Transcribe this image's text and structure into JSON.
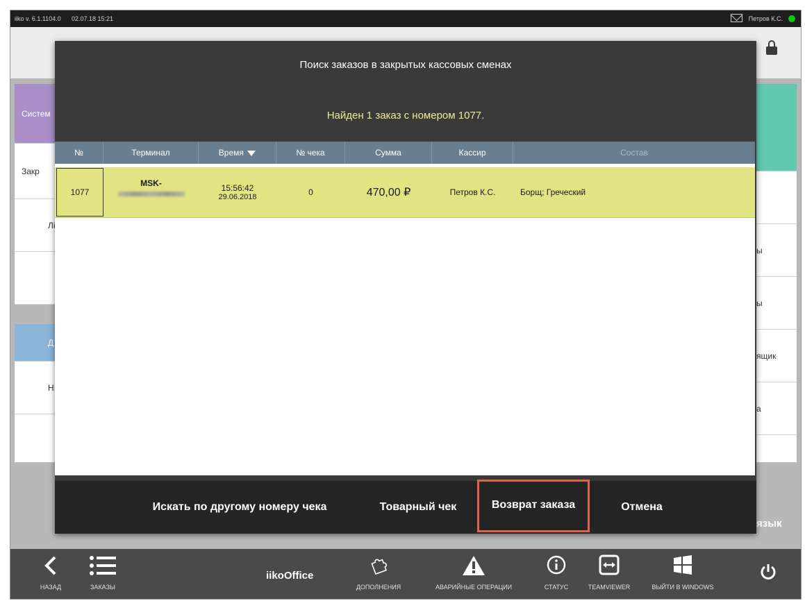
{
  "topbar": {
    "version": "iiko v. 6.1.1104.0",
    "datetime": "02.07.18  15:21",
    "user": "Петров К.С."
  },
  "background": {
    "left_tiles": [
      "Систем",
      "Закр",
      "Лі",
      "",
      "Д",
      "Н"
    ],
    "right_tiles": [
      "ы",
      "ы",
      "ящик",
      "а"
    ],
    "lang_label": "язык"
  },
  "modal": {
    "title": "Поиск заказов в закрытых кассовых сменах",
    "found_text": "Найден 1 заказ с номером 1077.",
    "columns": {
      "num": "№",
      "terminal": "Терминал",
      "time": "Время",
      "check": "№ чека",
      "sum": "Сумма",
      "cashier": "Кассир",
      "contents": "Состав"
    },
    "rows": [
      {
        "num": "1077",
        "terminal": "MSK-",
        "time": "15:56:42",
        "date": "29.06.2018",
        "check": "0",
        "sum": "470,00 ₽",
        "cashier": "Петров К.С.",
        "contents": "Борщ; Греческий"
      }
    ],
    "buttons": {
      "search_other": "Искать по другому номеру чека",
      "receipt": "Товарный чек",
      "return": "Возврат заказа",
      "cancel": "Отмена"
    }
  },
  "footer": {
    "back": "НАЗАД",
    "orders": "ЗАКАЗЫ",
    "iikooffice": "iikoOffice",
    "addons": "ДОПОЛНЕНИЯ",
    "emergency": "АВАРИЙНЫЕ ОПЕРАЦИИ",
    "status": "СТАТУС",
    "teamviewer": "TEAMVIEWER",
    "exit_windows": "ВЫЙТИ В WINDOWS"
  },
  "colors": {
    "modal_bg": "#3a3a3a",
    "header_row": "#687f92",
    "selected_row": "#e2e383",
    "found_text": "#ecec90",
    "highlight_border": "#e0634a",
    "status_dot": "#13c413"
  },
  "icons": [
    "mail-icon",
    "lock-icon",
    "sort-desc-icon",
    "back-icon",
    "list-icon",
    "puzzle-icon",
    "warning-icon",
    "info-icon",
    "teamviewer-icon",
    "windows-icon",
    "power-icon"
  ]
}
